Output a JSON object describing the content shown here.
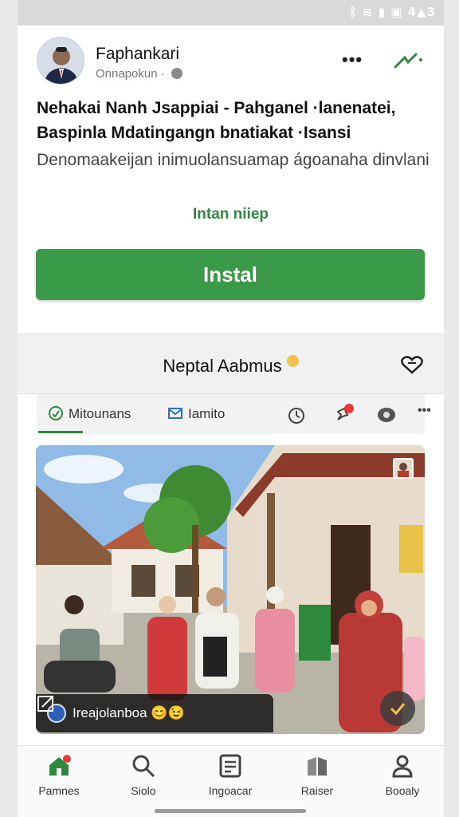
{
  "status": {
    "icons_text": "ᛒ ≋ ▮ ▣ 4▲3"
  },
  "post": {
    "author": "Faphankari",
    "subline": "Onnapokun ·",
    "headline": "Nehakai Nanh Jsappiai - Pahganel ·lanenatei, Baspinla Mdatingangn bnatiakat ·Isansi",
    "description": "Denomaakeijan inimuolansuamap ágoanaha dinvlani",
    "install_link": "Intan niiep",
    "install_button": "Instal"
  },
  "album": {
    "title": "Neptal Aabmus"
  },
  "tabs": [
    {
      "label": "Mitounans"
    },
    {
      "label": "Iamito"
    }
  ],
  "photo": {
    "caption": "Ireajolanboa 😊😉"
  },
  "nav": [
    {
      "label": "Pamnes"
    },
    {
      "label": "Siolo"
    },
    {
      "label": "Ingoacar"
    },
    {
      "label": "Raiser"
    },
    {
      "label": "Booaly"
    }
  ],
  "colors": {
    "accent": "#3a9a47",
    "accent_text": "#2d8a3c",
    "badge_red": "#e53935"
  }
}
